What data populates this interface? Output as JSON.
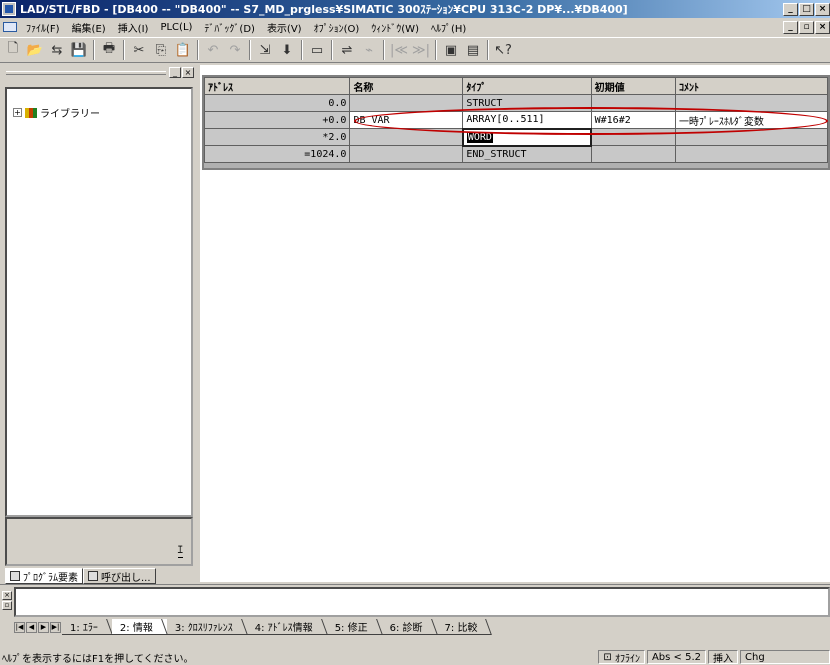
{
  "window": {
    "title": "LAD/STL/FBD  - [DB400 -- \"DB400\" -- S7_MD_prgless¥SIMATIC 300ｽﾃｰｼｮﾝ¥CPU 313C-2 DP¥...¥DB400]",
    "min_label": "_",
    "max_label": "□",
    "close_label": "×"
  },
  "menu": {
    "items": [
      "ﾌｧｲﾙ(F)",
      "編集(E)",
      "挿入(I)",
      "PLC(L)",
      "ﾃﾞﾊﾞｯｸﾞ(D)",
      "表示(V)",
      "ｵﾌﾟｼｮﾝ(O)",
      "ｳｨﾝﾄﾞｳ(W)",
      "ﾍﾙﾌﾟ(H)"
    ],
    "restore_label": "_",
    "maxdoc_label": "▫",
    "closedoc_label": "×"
  },
  "toolbar": {
    "icons": [
      "new-icon",
      "open-icon",
      "accessible-nodes-icon",
      "save-icon",
      "print-icon",
      "cut-icon",
      "copy-icon",
      "paste-icon",
      "undo-icon",
      "redo-icon",
      "load-icon",
      "download-icon",
      "monitor-icon",
      "online-icon",
      "offline-icon",
      "prev-icon",
      "next-icon",
      "overview-icon",
      "details-icon",
      "help-icon"
    ]
  },
  "left_pane": {
    "tree_items": [
      {
        "label": "ライブラリー"
      }
    ],
    "info_hint": "ｴ",
    "tabs": [
      {
        "label": "ﾌﾟﾛｸﾞﾗﾑ要素"
      },
      {
        "label": "呼び出し..."
      }
    ]
  },
  "table": {
    "headers": {
      "address": "ｱﾄﾞﾚｽ",
      "name": "名称",
      "type": "ﾀｲﾌﾟ",
      "initial": "初期値",
      "comment": "ｺﾒﾝﾄ"
    },
    "rows": [
      {
        "address": "0.0",
        "name": "",
        "type": "STRUCT",
        "initial": "",
        "comment": ""
      },
      {
        "address": "+0.0",
        "name": "DB_VAR",
        "type": "ARRAY[0..511]",
        "initial": "W#16#2",
        "comment": "一時ﾌﾟﾚｰｽﾎﾙﾀﾞ変数"
      },
      {
        "address": "*2.0",
        "name": "",
        "type": "WORD",
        "initial": "",
        "comment": ""
      },
      {
        "address": "=1024.0",
        "name": "",
        "type": "END_STRUCT",
        "initial": "",
        "comment": ""
      }
    ]
  },
  "messages": {
    "tabs": [
      "1: ｴﾗｰ",
      "2: 情報",
      "3: ｸﾛｽﾘﾌｧﾚﾝｽ",
      "4: ｱﾄﾞﾚｽ情報",
      "5: 修正",
      "6: 診断",
      "7: 比較"
    ]
  },
  "status": {
    "help_text": "ﾍﾙﾌﾟを表示するにはF1を押してください。",
    "online_state": "ｵﾌﾗｲﾝ",
    "position": "Abs < 5.2",
    "mode": "挿入",
    "change": "Chg"
  },
  "colors": {
    "title_start": "#0a246a",
    "title_end": "#a6caf0",
    "annotation": "#c00000"
  }
}
